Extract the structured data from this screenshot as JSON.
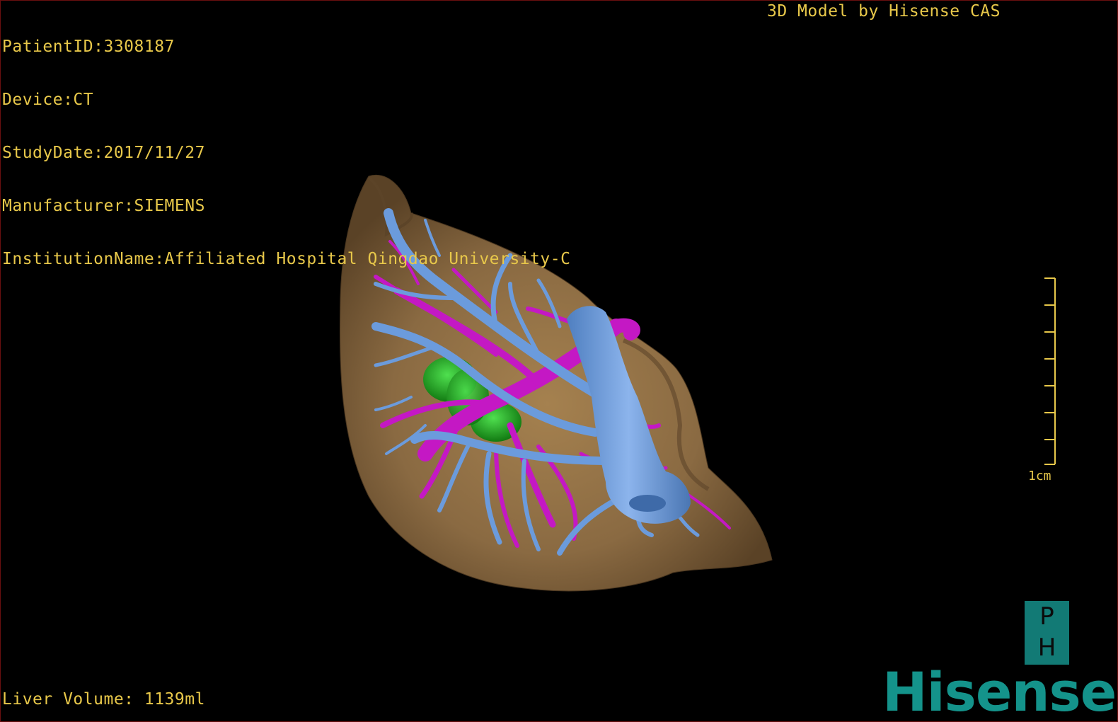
{
  "study_info": {
    "patient_id": "PatientID:3308187",
    "device": "Device:CT",
    "study_date": "StudyDate:2017/11/27",
    "manufacturer": "Manufacturer:SIEMENS",
    "institution": "InstitutionName:Affiliated Hospital Qingdao University-C"
  },
  "header_right": "3D Model by Hisense CAS",
  "liver_volume": "Liver Volume: 1139ml",
  "scale": {
    "label": "1cm",
    "ticks": 8
  },
  "logos": {
    "ph_top": "P",
    "ph_bottom": "H",
    "brand": "Hisense"
  },
  "colors": {
    "overlay_text": "#e8c84a",
    "liver": "#8a6a42",
    "hepatic_vein": "#6b9bdc",
    "portal_vein": "#c418c4",
    "tumor": "#1fa81f",
    "brand": "#14938b"
  }
}
